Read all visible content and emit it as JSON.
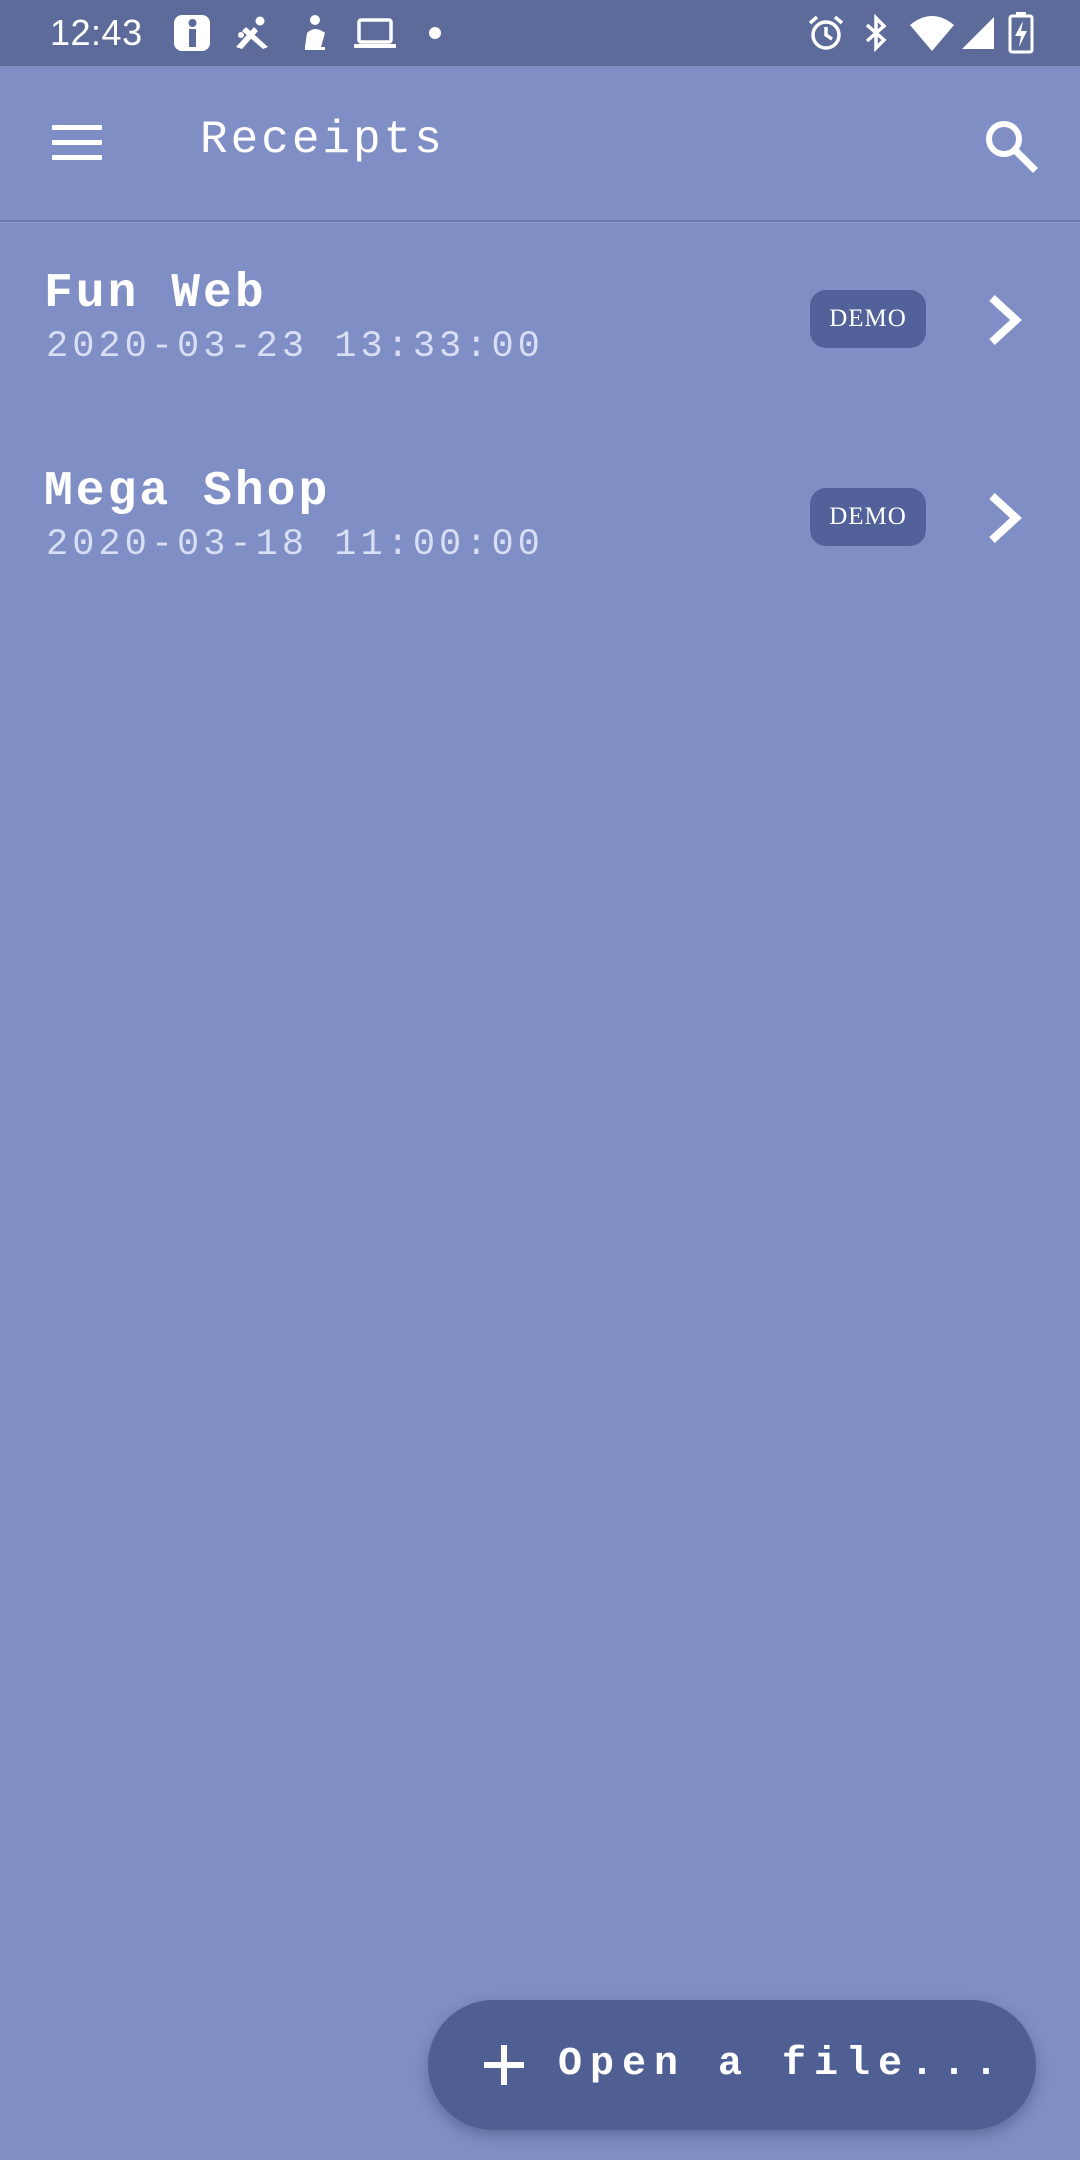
{
  "status_bar": {
    "time": "12:43",
    "left_icons": [
      "info-app-icon",
      "caixabank-icon",
      "stork-icon",
      "laptop-icon",
      "dot-icon"
    ],
    "right_icons": [
      "alarm-icon",
      "bluetooth-icon",
      "wifi-icon",
      "cell-signal-icon",
      "battery-charging-icon"
    ]
  },
  "app_bar": {
    "title": "Receipts",
    "menu_icon": "menu-icon",
    "search_icon": "search-icon"
  },
  "receipts": [
    {
      "name": "Fun Web",
      "datetime": "2020-03-23 13:33:00",
      "badge": "DEMO"
    },
    {
      "name": "Mega Shop",
      "datetime": "2020-03-18 11:00:00",
      "badge": "DEMO"
    }
  ],
  "fab": {
    "icon": "plus-icon",
    "label": "Open a file..."
  },
  "colors": {
    "background": "#7f8ec4",
    "status_bar": "#5c6b99",
    "badge": "#52619a",
    "fab": "#4f5f94"
  }
}
